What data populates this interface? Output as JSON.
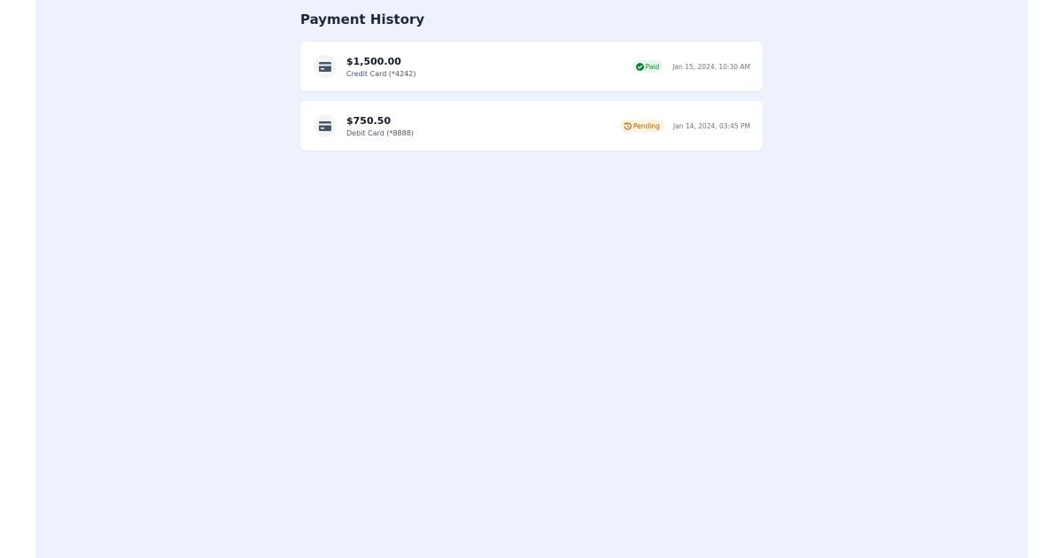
{
  "page": {
    "title": "Payment History"
  },
  "payments": [
    {
      "amount": "$1,500.00",
      "method": "Credit Card (*4242)",
      "status": "Paid",
      "status_icon": "check-circle-icon",
      "timestamp": "Jan 15, 2024, 10:30 AM"
    },
    {
      "amount": "$750.50",
      "method": "Debit Card (*8888)",
      "status": "Pending",
      "status_icon": "history-clock-icon",
      "timestamp": "Jan 14, 2024, 03:45 PM"
    }
  ],
  "colors": {
    "background": "#eef2fd",
    "card": "#ffffff",
    "paid_text": "#15803d",
    "paid_bg": "#e8f7ee",
    "pending_text": "#a16207",
    "pending_bg": "#fdf3de",
    "icon": "#475569"
  }
}
